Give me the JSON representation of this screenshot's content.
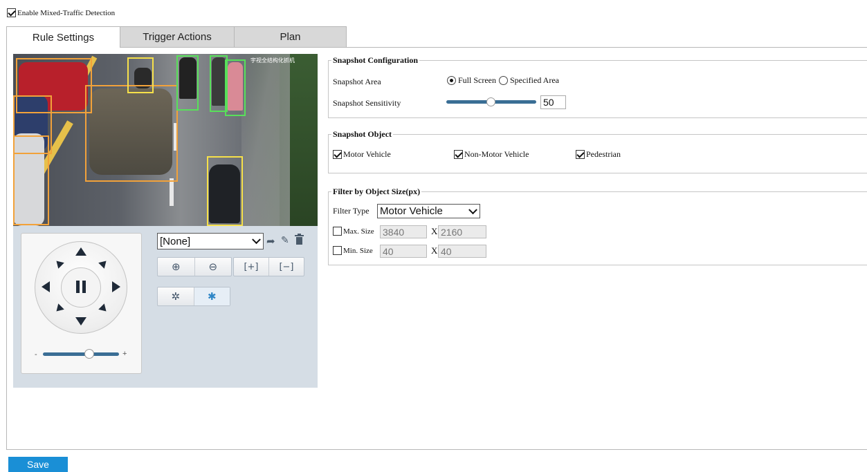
{
  "top": {
    "enable_label": "Enable Mixed-Traffic Detection",
    "enabled": true
  },
  "tabs": [
    {
      "label": "Rule Settings",
      "active": true
    },
    {
      "label": "Trigger Actions",
      "active": false
    },
    {
      "label": "Plan",
      "active": false
    }
  ],
  "video": {
    "watermark": "宇视全结构化抓机"
  },
  "ptz": {
    "preset_value": "[None]",
    "preset_icons": [
      "go-to-preset-icon",
      "edit-preset-icon",
      "delete-preset-icon"
    ],
    "zoom_icons": [
      "zoom-in-icon",
      "zoom-out-icon",
      "focus-near-icon",
      "focus-far-icon"
    ],
    "extra_icons": [
      "wiper-icon",
      "light-icon"
    ],
    "speed_minus": "-",
    "speed_plus": "+",
    "speed_level": 0.6
  },
  "snapshot_config": {
    "title": "Snapshot Configuration",
    "area_label": "Snapshot Area",
    "area_options": [
      {
        "label": "Full Screen",
        "selected": true
      },
      {
        "label": "Specified Area",
        "selected": false
      }
    ],
    "sensitivity_label": "Snapshot Sensitivity",
    "sensitivity_value": "50",
    "sensitivity_level": 0.5
  },
  "snapshot_object": {
    "title": "Snapshot Object",
    "items": [
      {
        "label": "Motor Vehicle",
        "checked": true
      },
      {
        "label": "Non-Motor Vehicle",
        "checked": true
      },
      {
        "label": "Pedestrian",
        "checked": true
      }
    ]
  },
  "filter": {
    "title": "Filter by Object Size(px)",
    "type_label": "Filter Type",
    "type_value": "Motor Vehicle",
    "max_label": "Max. Size",
    "max_w": "3840",
    "max_h": "2160",
    "min_label": "Min. Size",
    "min_w": "40",
    "min_h": "40",
    "x_label": "X",
    "max_checked": false,
    "min_checked": false
  },
  "save_label": "Save",
  "colors": {
    "save": "#1a8fd6",
    "slider": "#3a6e95",
    "box_orange": "#f2a23a",
    "box_green": "#58e05a",
    "box_yellow": "#f7e14a"
  }
}
